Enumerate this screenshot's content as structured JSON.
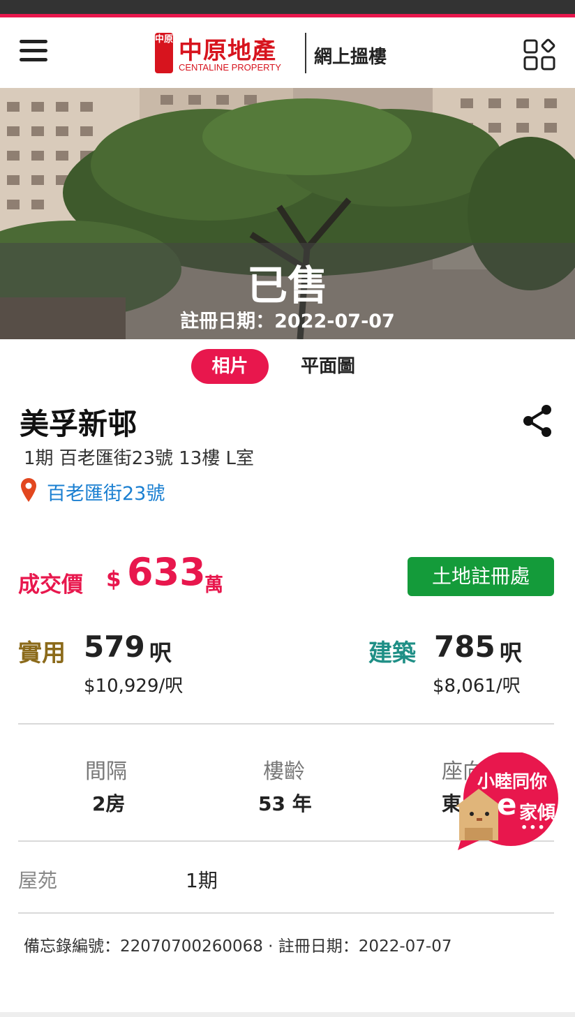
{
  "header": {
    "logo_seal": "中原",
    "logo_cn": "中原地產",
    "logo_en": "CENTALINE PROPERTY",
    "subtitle": "網上搵樓"
  },
  "hero": {
    "status": "已售",
    "registration": "註冊日期：2022-07-07"
  },
  "tabs": [
    {
      "label": "相片",
      "active": true
    },
    {
      "label": "平面圖",
      "active": false
    }
  ],
  "listing": {
    "estate_name": "美孚新邨",
    "address": "1期 百老匯街23號 13樓 L室",
    "street": "百老匯街23號"
  },
  "price": {
    "label": "成交價",
    "currency": "$",
    "value": "633",
    "unit": "萬"
  },
  "land_registry_button": "土地註冊處",
  "area": {
    "saleable_label": "實用",
    "saleable_value": "579",
    "saleable_unit": "呎",
    "saleable_psf": "$10,929/呎",
    "gross_label": "建築",
    "gross_value": "785",
    "gross_unit": "呎",
    "gross_psf": "$8,061/呎"
  },
  "specs": {
    "layout_label": "間隔",
    "layout_value": "2房",
    "age_label": "樓齡",
    "age_value": "53 年",
    "facing_label": "座向",
    "facing_value": "東"
  },
  "phase": {
    "label": "屋苑",
    "value": "1期"
  },
  "memo": "備忘錄編號：22070700260068 · 註冊日期：2022-07-07",
  "chat": {
    "line1": "小睦同你",
    "line2_e": "e",
    "line2": "家傾",
    "dots": "•••"
  },
  "colors": {
    "brand_red": "#d7141e",
    "accent_pink": "#e8174d",
    "registry_green": "#149b3a",
    "saleable_gold": "#8b6a1a",
    "gross_teal": "#1f8f86",
    "link_blue": "#1a7fd1"
  }
}
